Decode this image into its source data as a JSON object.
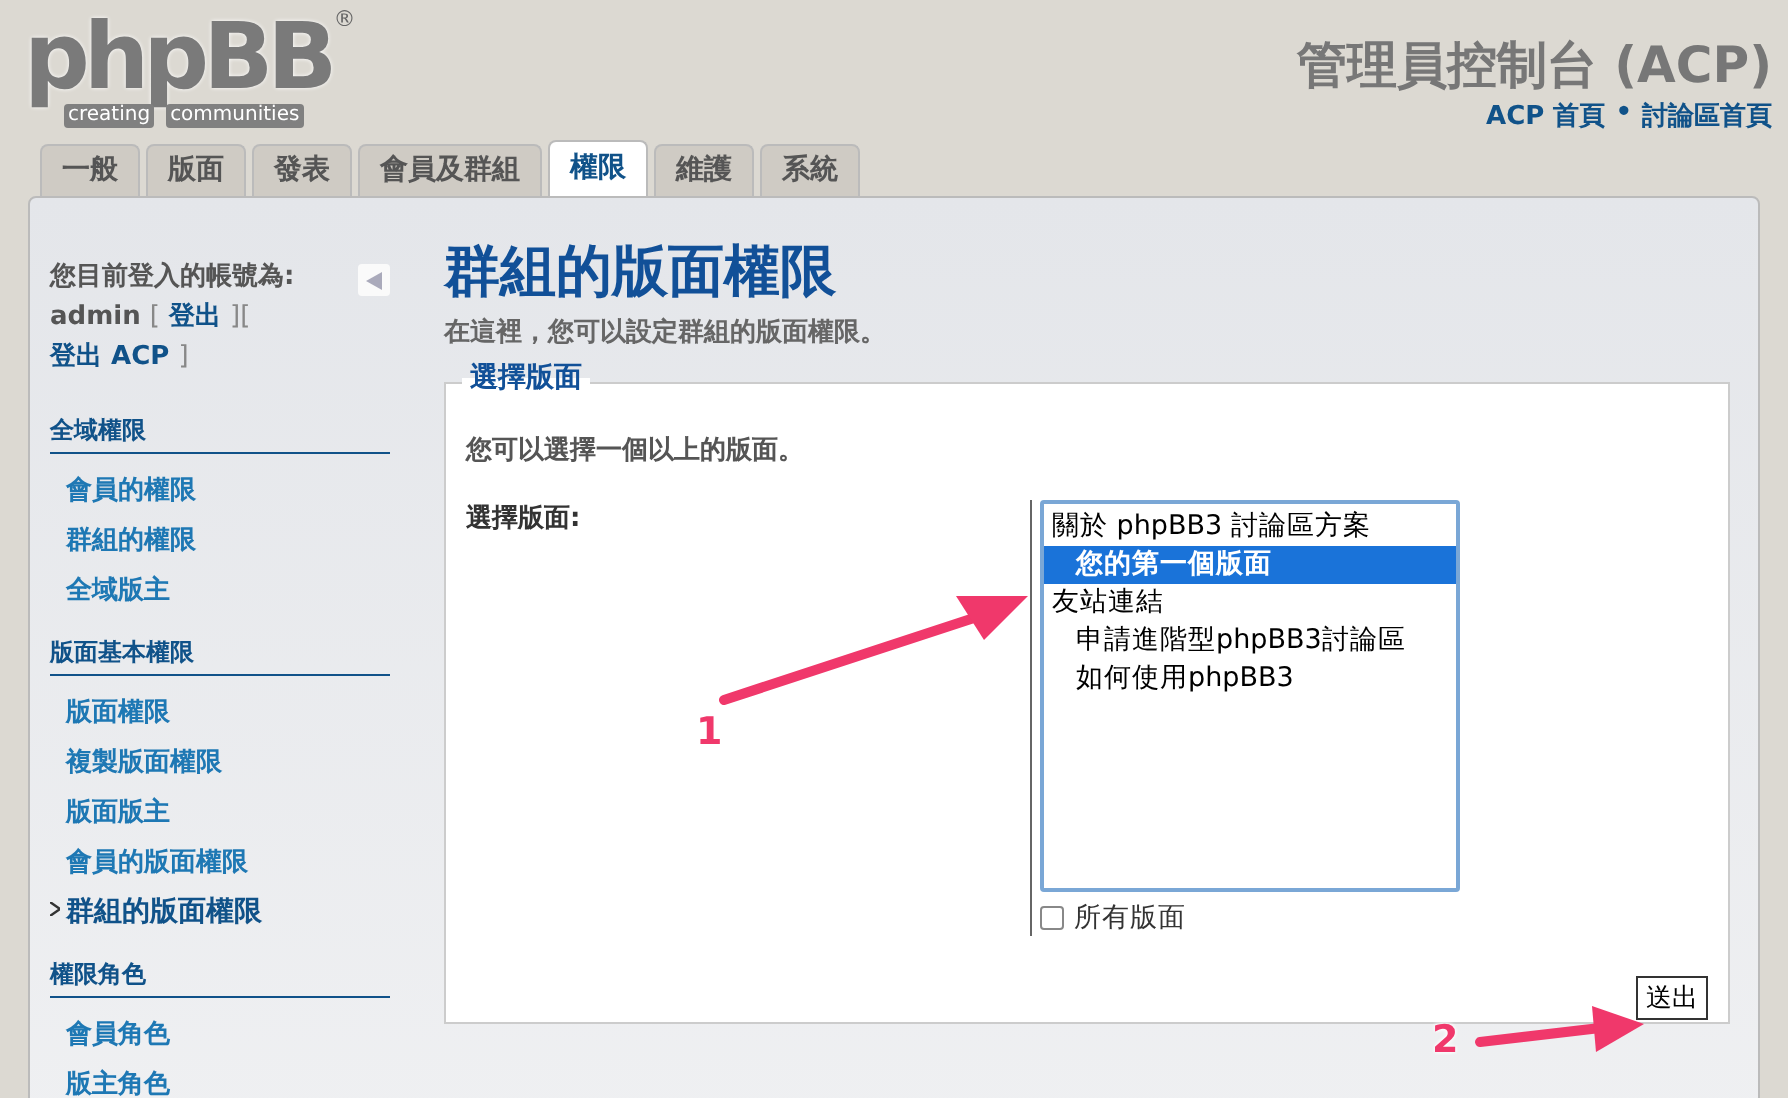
{
  "header": {
    "logo": {
      "wordmark": "phpBB",
      "registered": "®",
      "tagline": [
        "creating",
        "communities"
      ]
    },
    "title": "管理員控制台 (ACP)",
    "links": [
      "ACP 首頁",
      "討論區首頁"
    ],
    "separator": "•"
  },
  "tabs": [
    {
      "label": "一般",
      "selected": false
    },
    {
      "label": "版面",
      "selected": false
    },
    {
      "label": "發表",
      "selected": false
    },
    {
      "label": "會員及群組",
      "selected": false
    },
    {
      "label": "權限",
      "selected": true
    },
    {
      "label": "維護",
      "selected": false
    },
    {
      "label": "系統",
      "selected": false
    }
  ],
  "sidebar": {
    "login_label": "您目前登入的帳號為:",
    "login_parts": [
      {
        "text": "admin",
        "kind": "user"
      },
      {
        "text": "[",
        "kind": "punct"
      },
      {
        "text": "登出",
        "kind": "link"
      },
      {
        "text": "][",
        "kind": "punct"
      },
      {
        "text": "登出 ACP",
        "kind": "link"
      },
      {
        "text": "]",
        "kind": "punct"
      }
    ],
    "sections": [
      {
        "title": "全域權限",
        "items": [
          {
            "label": "會員的權限",
            "selected": false
          },
          {
            "label": "群組的權限",
            "selected": false
          },
          {
            "label": "全域版主",
            "selected": false
          }
        ]
      },
      {
        "title": "版面基本權限",
        "items": [
          {
            "label": "版面權限",
            "selected": false
          },
          {
            "label": "複製版面權限",
            "selected": false
          },
          {
            "label": "版面版主",
            "selected": false
          },
          {
            "label": "會員的版面權限",
            "selected": false
          },
          {
            "label": "群組的版面權限",
            "selected": true
          }
        ]
      },
      {
        "title": "權限角色",
        "items": [
          {
            "label": "會員角色",
            "selected": false
          },
          {
            "label": "版主角色",
            "selected": false
          }
        ]
      }
    ]
  },
  "main": {
    "title": "群組的版面權限",
    "description": "在這裡，您可以設定群組的版面權限。",
    "fieldset": {
      "legend": "選擇版面",
      "hint": "您可以選擇一個以上的版面。",
      "field_label": "選擇版面:",
      "forums": [
        {
          "label": "關於 phpBB3 討論區方案",
          "selected": false,
          "children": [
            {
              "label": "您的第一個版面",
              "selected": true
            }
          ]
        },
        {
          "label": "友站連結",
          "selected": false,
          "children": [
            {
              "label": "申請進階型phpBB3討論區",
              "selected": false
            },
            {
              "label": "如何使用phpBB3",
              "selected": false
            }
          ]
        }
      ],
      "all_forums": {
        "label": "所有版面",
        "checked": false
      },
      "submit": "送出"
    }
  },
  "annotations": [
    {
      "label": "1"
    },
    {
      "label": "2"
    }
  ]
}
